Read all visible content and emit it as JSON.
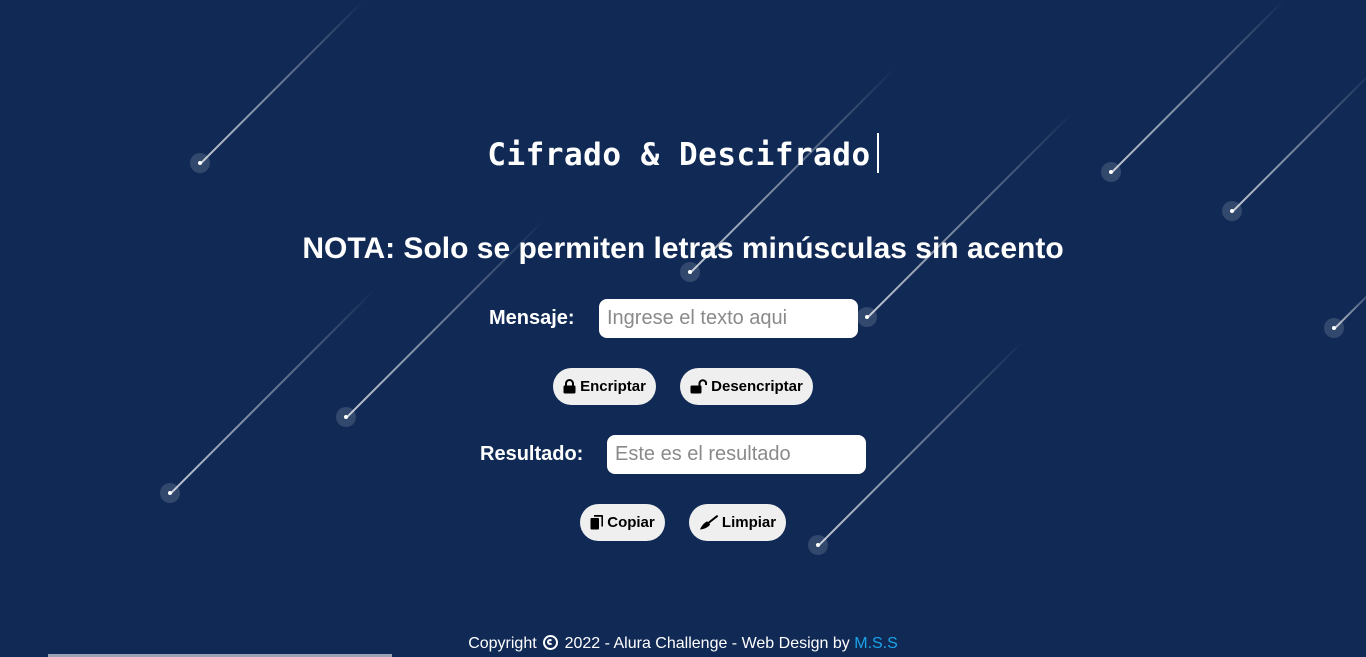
{
  "header": {
    "title": "Cifrado & Descifrado"
  },
  "note": {
    "text": "NOTA: Solo se permiten letras minúsculas sin acento"
  },
  "form": {
    "message_label": "Mensaje:",
    "message_placeholder": "Ingrese el texto aqui",
    "encrypt_label": "Encriptar",
    "decrypt_label": "Desencriptar",
    "result_label": "Resultado:",
    "result_placeholder": "Este es el resultado",
    "copy_label": "Copiar",
    "clear_label": "Limpiar"
  },
  "icons": {
    "encrypt": "lock-icon",
    "decrypt": "unlock-icon",
    "copy": "copy-icon",
    "clear": "broom-icon",
    "copyright": "copyright-icon"
  },
  "footer": {
    "prefix": "Copyright",
    "text": "2022 - Alura Challenge - Web Design by",
    "author_link": "M.S.S"
  },
  "colors": {
    "background": "#112a55",
    "button": "#efefef",
    "link": "#1aa3e8"
  }
}
